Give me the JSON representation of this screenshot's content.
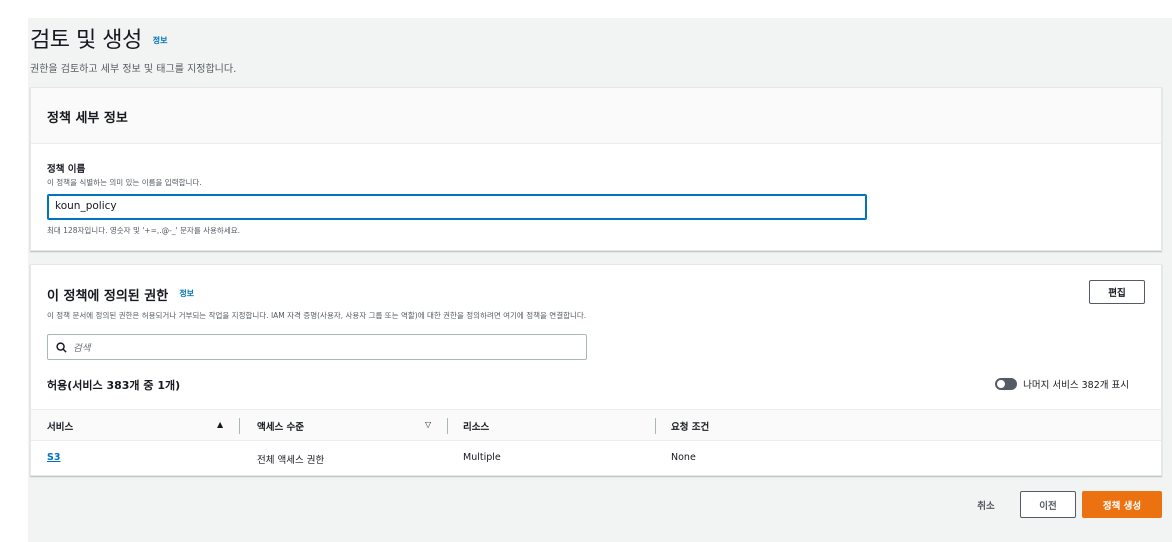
{
  "header": {
    "title": "검토 및 생성",
    "info": "정보",
    "subtitle": "권한을 검토하고 세부 정보 및 태그를 지정합니다."
  },
  "policy_details": {
    "heading": "정책 세부 정보",
    "name_label": "정책 이름",
    "name_desc": "이 정책을 식별하는 의미 있는 이름을 입력합니다.",
    "name_value": "koun_policy",
    "name_hint": "최대 128자입니다. 영숫자 및 '+=,.@-_' 문자를 사용하세요."
  },
  "permissions": {
    "heading": "이 정책에 정의된 권한",
    "info": "정보",
    "desc": "이 정책 문서에 정의된 권한은 허용되거나 거부되는 작업을 지정합니다. IAM 자격 증명(사용자, 사용자 그룹 또는 역할)에 대한 권한을 정의하려면 여기에 정책을 연결합니다.",
    "edit_label": "편집",
    "search_placeholder": "검색",
    "allow_title": "허용(서비스 383개 중 1개)",
    "toggle_label": "나머지 서비스 382개 표시",
    "columns": [
      "서비스",
      "액세스 수준",
      "리소스",
      "요청 조건"
    ],
    "rows": [
      {
        "service": "S3",
        "access": "전체 액세스 권한",
        "resource": "Multiple",
        "condition": "None"
      }
    ]
  },
  "footer": {
    "cancel": "취소",
    "previous": "이전",
    "create": "정책 생성"
  },
  "colors": {
    "accent": "#ec7211",
    "link": "#0073bb"
  },
  "icons": [
    "search-icon",
    "sort-asc-icon",
    "sort-desc-icon",
    "toggle-icon"
  ]
}
